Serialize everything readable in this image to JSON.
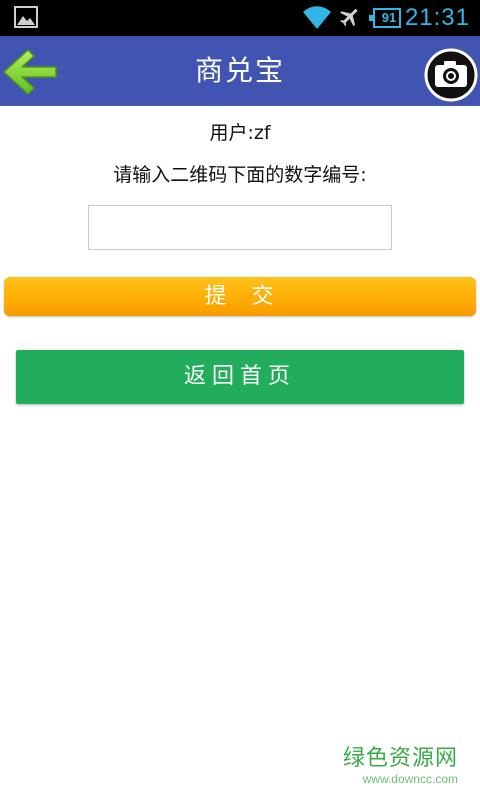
{
  "status_bar": {
    "battery_level": "91",
    "time": "21:31",
    "icons": [
      "gallery-icon",
      "wifi-icon",
      "airplane-icon",
      "battery-icon"
    ],
    "color": "#33b5e5"
  },
  "header": {
    "title": "商兑宝",
    "background_color": "#4154b1",
    "back_icon": "green-arrow-left-icon",
    "camera_icon": "camera-icon"
  },
  "content": {
    "user_label": "用户:zf",
    "prompt_label": "请输入二维码下面的数字编号:",
    "code_input": {
      "value": "",
      "placeholder": ""
    },
    "submit_label": "提 交",
    "home_label": "返回首页",
    "submit_color": "#ffae05",
    "home_color": "#22ad5c"
  },
  "watermark": {
    "title": "绿色资源网",
    "url": "www.downcc.com"
  }
}
